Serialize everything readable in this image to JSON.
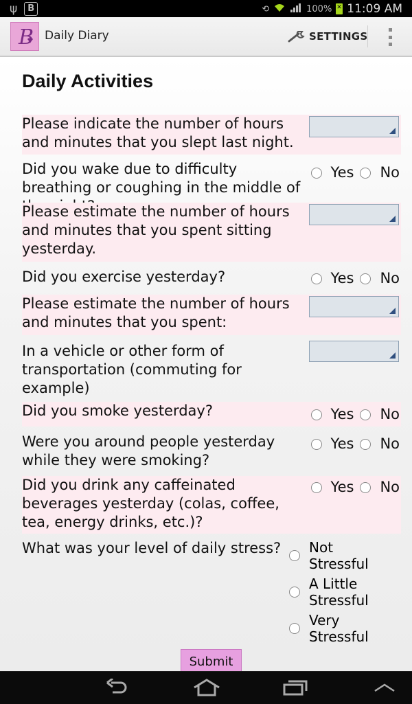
{
  "status_bar": {
    "battery_percent": "100%",
    "time": "11:09 AM",
    "icons": [
      "usb-icon",
      "app-b-icon",
      "sync-icon",
      "wifi-icon",
      "signal-icon",
      "battery-charging-icon"
    ]
  },
  "action_bar": {
    "app_icon_letter": "B",
    "title": "Daily Diary",
    "settings_label": "SETTINGS"
  },
  "page_title": "Daily Activities",
  "questions": [
    {
      "text": "Please indicate the number of hours and minutes that you slept last night.",
      "type": "spinner",
      "value": ""
    },
    {
      "text": "Did you wake due to difficulty breathing or coughing in the middle of the night?",
      "type": "yesno"
    },
    {
      "text": "Please estimate the number of hours and minutes that you spent sitting yesterday.",
      "type": "spinner",
      "value": ""
    },
    {
      "text": "Did you exercise yesterday?",
      "type": "yesno"
    },
    {
      "text": "Please estimate the number of hours and minutes that you spent:",
      "type": "spinner",
      "value": ""
    },
    {
      "text": "In a vehicle or other form of transportation (commuting for example)",
      "type": "spinner",
      "value": ""
    },
    {
      "text": "Did you smoke yesterday?",
      "type": "yesno"
    },
    {
      "text": "Were you around people yesterday while they were smoking?",
      "type": "yesno"
    },
    {
      "text": "Did you drink any caffeinated beverages yesterday (colas, coffee, tea, energy drinks, etc.)?",
      "type": "yesno"
    },
    {
      "text": "What was your level of daily stress?",
      "type": "stress"
    }
  ],
  "yes_label": "Yes",
  "no_label": "No",
  "stress_options": [
    {
      "line1": "Not",
      "line2": "Stressful"
    },
    {
      "line1": "A Little",
      "line2": "Stressful"
    },
    {
      "line1": "Very",
      "line2": "Stressful"
    }
  ],
  "submit_label": "Submit",
  "colors": {
    "row_highlight": "#fdebf0",
    "submit_bg": "#e7a0e0",
    "spinner_bg": "#dee4ea",
    "app_icon_bg": "#e9a7d8"
  }
}
